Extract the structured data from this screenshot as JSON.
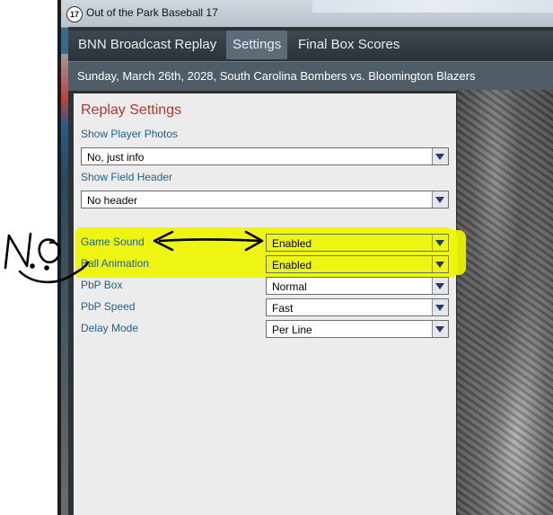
{
  "window": {
    "app_badge": "17",
    "title": "Out of the Park Baseball 17"
  },
  "tabs": [
    {
      "label": "BNN Broadcast Replay"
    },
    {
      "label": "Settings"
    },
    {
      "label": "Final Box Scores"
    }
  ],
  "subheader": "Sunday, March 26th, 2028, South Carolina Bombers vs. Bloomington Blazers",
  "panel": {
    "title": "Replay Settings",
    "settings": [
      {
        "label": "Show Player Photos",
        "value": "No, just info"
      },
      {
        "label": "Show Field Header",
        "value": "No header"
      },
      {
        "label": "Game Sound",
        "value": "Enabled"
      },
      {
        "label": "Ball Animation",
        "value": "Enabled"
      },
      {
        "label": "PbP Box",
        "value": "Normal"
      },
      {
        "label": "PbP Speed",
        "value": "Fast"
      },
      {
        "label": "Delay Mode",
        "value": "Per Line"
      }
    ]
  },
  "annotation": {
    "handwriting": "NO",
    "highlight_color": "#eef500",
    "ink_color": "#000000"
  },
  "colors": {
    "label": "#1f5f8f",
    "title": "#b5352f",
    "tab_active": "#5b6b78",
    "panel": "#ececec"
  }
}
